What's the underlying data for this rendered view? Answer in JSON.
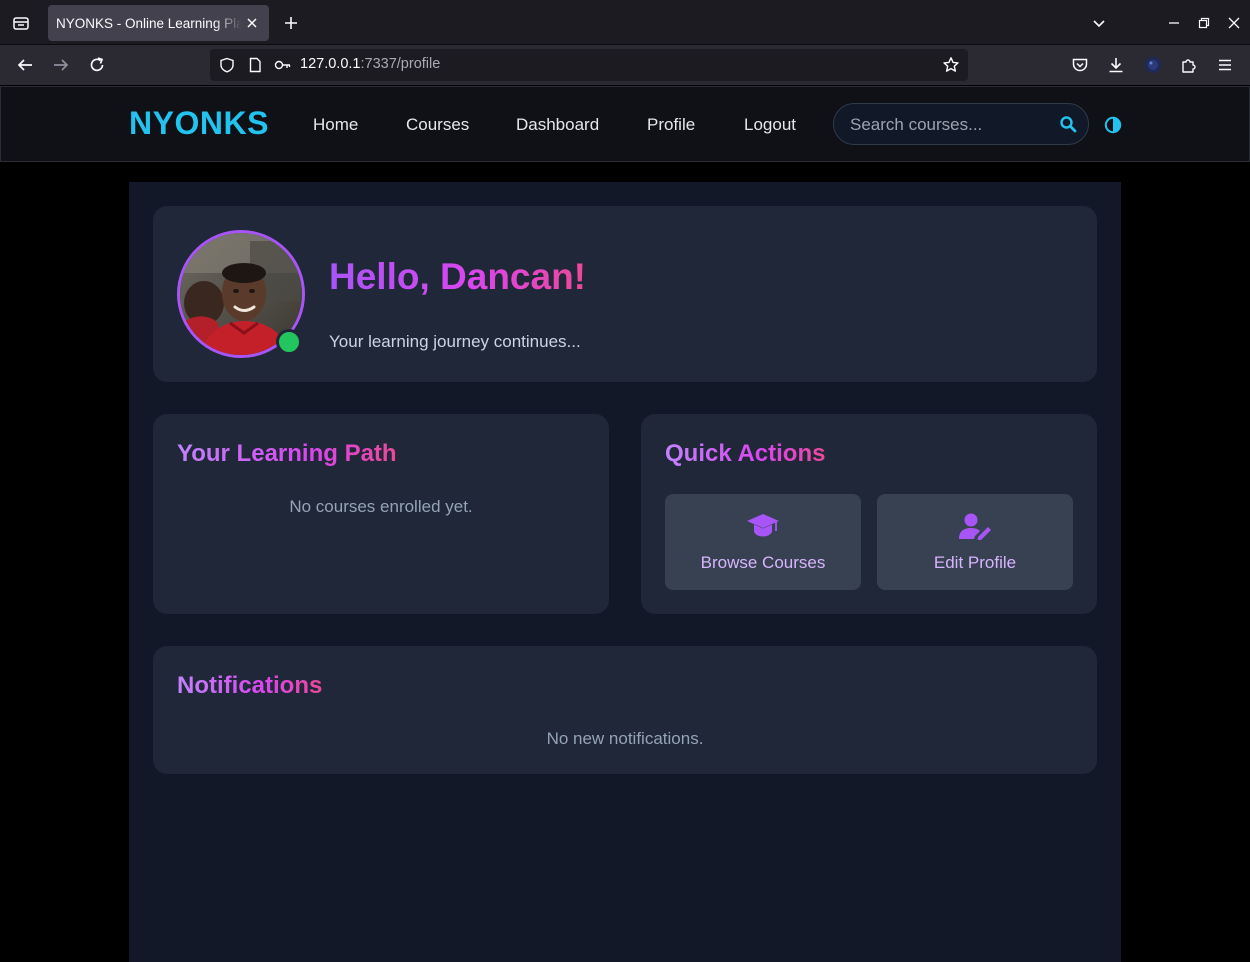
{
  "browser": {
    "tab_title": "NYONKS - Online Learning Platform",
    "url_host": "127.0.0.1",
    "url_path": ":7337/profile",
    "icons": [
      "tab-list-icon",
      "close-icon",
      "plus-icon",
      "chevron-down-icon",
      "minimize-icon",
      "restore-icon",
      "close-window-icon",
      "back-icon",
      "forward-icon",
      "reload-icon",
      "shield-icon",
      "page-icon",
      "key-icon",
      "star-icon",
      "pocket-icon",
      "download-icon",
      "account-icon",
      "extensions-icon",
      "menu-icon"
    ]
  },
  "header": {
    "brand": "NYONKS",
    "nav": [
      {
        "label": "Home"
      },
      {
        "label": "Courses"
      },
      {
        "label": "Dashboard"
      },
      {
        "label": "Profile"
      },
      {
        "label": "Logout"
      }
    ],
    "search_placeholder": "Search courses...",
    "accent": "#22c3ee"
  },
  "hero": {
    "greeting": "Hello, Dancan!",
    "subtitle": "Your learning journey continues...",
    "status": "online",
    "status_color": "#22c55e"
  },
  "learning_path": {
    "title": "Your Learning Path",
    "empty_message": "No courses enrolled yet."
  },
  "quick_actions": {
    "title": "Quick Actions",
    "buttons": [
      {
        "label": "Browse Courses",
        "icon": "graduation-cap-icon"
      },
      {
        "label": "Edit Profile",
        "icon": "user-edit-icon"
      }
    ]
  },
  "notifications": {
    "title": "Notifications",
    "empty_message": "No new notifications."
  },
  "colors": {
    "gradient_start": "#a855f7",
    "gradient_end": "#ec4899",
    "card_bg": "#1f2738",
    "page_bg": "#121827"
  }
}
